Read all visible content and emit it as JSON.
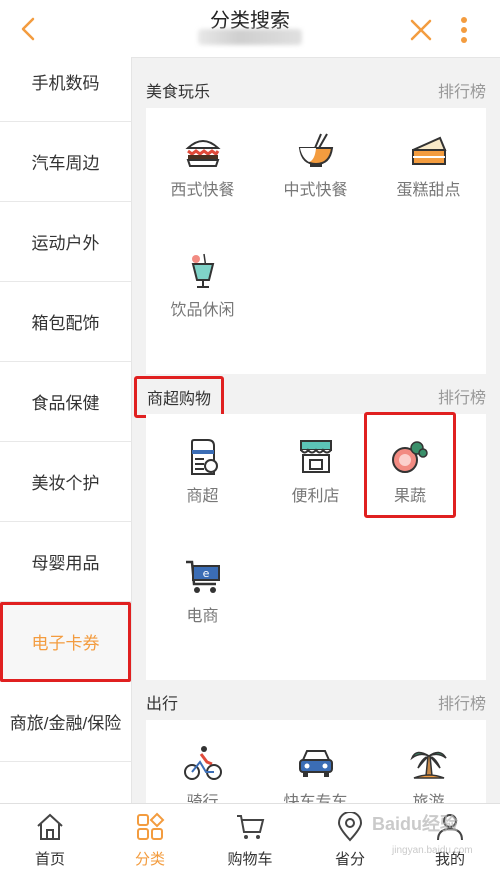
{
  "header": {
    "title": "分类搜索",
    "back_icon": "chevron-left-icon",
    "close_icon": "close-icon",
    "more_icon": "more-vertical-icon",
    "accent": "#f39c3f"
  },
  "sidebar": {
    "items": [
      {
        "label": "手机数码"
      },
      {
        "label": "汽车周边"
      },
      {
        "label": "运动户外"
      },
      {
        "label": "箱包配饰"
      },
      {
        "label": "食品保健"
      },
      {
        "label": "美妆个护"
      },
      {
        "label": "母婴用品"
      },
      {
        "label": "电子卡券",
        "active": true
      },
      {
        "label": "商旅/金融/保险"
      }
    ]
  },
  "sections": [
    {
      "title": "美食玩乐",
      "rank": "排行榜",
      "items": [
        {
          "label": "西式快餐",
          "icon": "burger-icon"
        },
        {
          "label": "中式快餐",
          "icon": "noodle-bowl-icon"
        },
        {
          "label": "蛋糕甜点",
          "icon": "cake-icon"
        },
        {
          "label": "饮品休闲",
          "icon": "drink-icon"
        }
      ]
    },
    {
      "title": "商超购物",
      "rank": "排行榜",
      "items": [
        {
          "label": "商超",
          "icon": "supermarket-icon"
        },
        {
          "label": "便利店",
          "icon": "store-icon"
        },
        {
          "label": "果蔬",
          "icon": "fruit-vegetable-icon"
        },
        {
          "label": "电商",
          "icon": "cart-icon"
        }
      ]
    },
    {
      "title": "出行",
      "rank": "排行榜",
      "items": [
        {
          "label": "骑行",
          "icon": "bicycle-icon"
        },
        {
          "label": "快车专车",
          "icon": "car-icon"
        },
        {
          "label": "旅游",
          "icon": "palm-tree-icon"
        }
      ]
    }
  ],
  "bottom_nav": [
    {
      "label": "首页",
      "icon": "home-icon"
    },
    {
      "label": "分类",
      "icon": "category-icon",
      "active": true
    },
    {
      "label": "购物车",
      "icon": "shopping-cart-icon"
    },
    {
      "label": "省分",
      "icon": "location-icon"
    },
    {
      "label": "我的",
      "icon": "user-icon"
    }
  ],
  "watermark": {
    "text": "Baidu经验",
    "sub": "jingyan.baidu.com"
  }
}
